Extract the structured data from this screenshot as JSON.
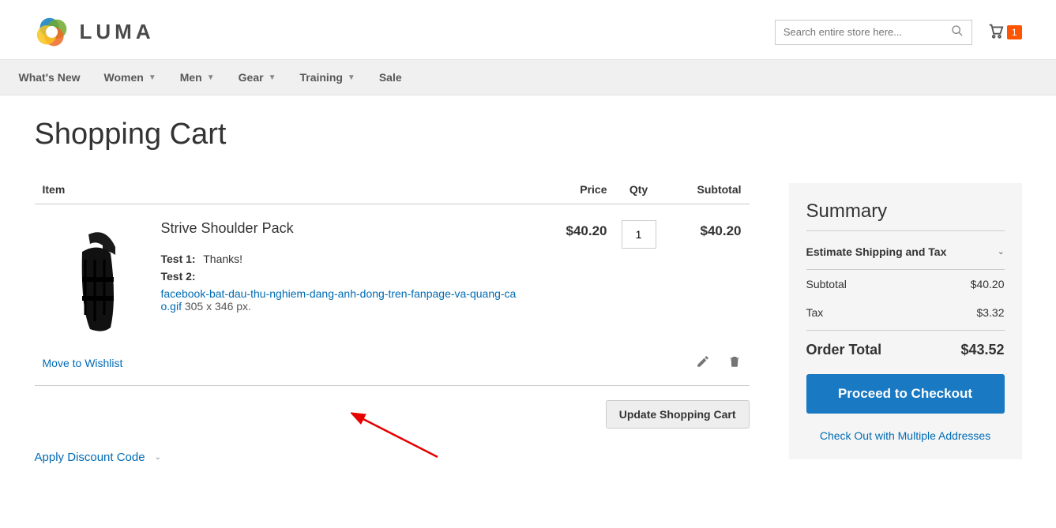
{
  "header": {
    "logo_text": "LUMA",
    "search_placeholder": "Search entire store here...",
    "cart_count": "1"
  },
  "nav": {
    "whats_new": "What's New",
    "women": "Women",
    "men": "Men",
    "gear": "Gear",
    "training": "Training",
    "sale": "Sale"
  },
  "page": {
    "title": "Shopping Cart"
  },
  "cart": {
    "head_item": "Item",
    "head_price": "Price",
    "head_qty": "Qty",
    "head_subtotal": "Subtotal",
    "items": [
      {
        "name": "Strive Shoulder Pack",
        "opt1_label": "Test 1:",
        "opt1_value": "Thanks!",
        "opt2_label": "Test 2:",
        "opt2_file": "facebook-bat-dau-thu-nghiem-dang-anh-dong-tren-fanpage-va-quang-cao.gif",
        "opt2_dim": " 305 x 346 px.",
        "price": "$40.20",
        "qty": "1",
        "subtotal": "$40.20"
      }
    ],
    "wishlist_link": "Move to Wishlist",
    "update_btn": "Update Shopping Cart",
    "discount_toggle": "Apply Discount Code"
  },
  "summary": {
    "title": "Summary",
    "estimate": "Estimate Shipping and Tax",
    "subtotal_label": "Subtotal",
    "subtotal_value": "$40.20",
    "tax_label": "Tax",
    "tax_value": "$3.32",
    "order_total_label": "Order Total",
    "order_total_value": "$43.52",
    "checkout_btn": "Proceed to Checkout",
    "multi_link": "Check Out with Multiple Addresses"
  }
}
